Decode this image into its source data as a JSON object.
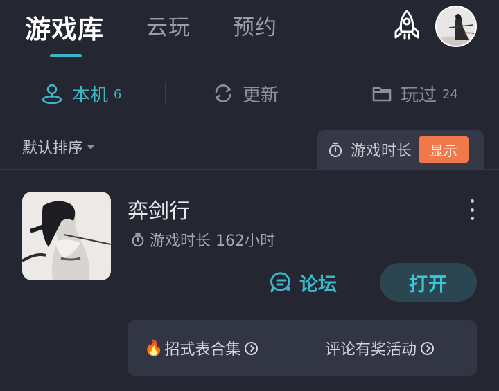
{
  "top_tabs": [
    {
      "label": "游戏库",
      "active": true
    },
    {
      "label": "云玩",
      "active": false
    },
    {
      "label": "预约",
      "active": false
    }
  ],
  "header_icons": {
    "rocket": "rocket-icon",
    "avatar": "user-avatar"
  },
  "sub_tabs": [
    {
      "label": "本机",
      "count": "6",
      "icon": "location-pin-icon",
      "active": true
    },
    {
      "label": "更新",
      "count": "",
      "icon": "refresh-icon",
      "active": false
    },
    {
      "label": "玩过",
      "count": "24",
      "icon": "folder-icon",
      "active": false
    }
  ],
  "sort": {
    "label": "默认排序"
  },
  "duration_toggle": {
    "label": "游戏时长",
    "button": "显示"
  },
  "game": {
    "title": "弈剑行",
    "playtime": "游戏时长 162小时",
    "forum_label": "论坛",
    "open_label": "打开"
  },
  "links": [
    {
      "label": "招式表合集",
      "prefix_icon": "fire-emoji"
    },
    {
      "label": "评论有奖活动"
    }
  ],
  "colors": {
    "background": "#242631",
    "accent": "#3cb6c8",
    "orange": "#f0784a",
    "panel": "#323544"
  }
}
